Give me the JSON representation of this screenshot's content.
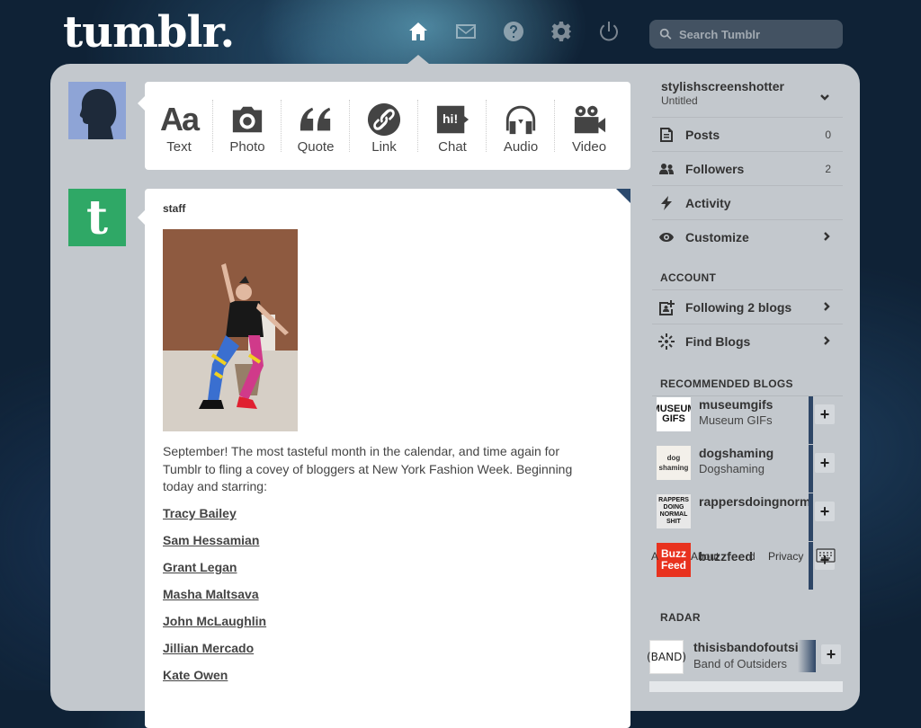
{
  "header": {
    "logo": "tumblr.",
    "nav": [
      {
        "name": "home",
        "icon": "home-icon",
        "active": true
      },
      {
        "name": "inbox",
        "icon": "envelope-icon",
        "active": false
      },
      {
        "name": "help",
        "icon": "question-icon",
        "active": false
      },
      {
        "name": "settings",
        "icon": "gear-icon",
        "active": false
      },
      {
        "name": "logout",
        "icon": "power-icon",
        "active": false
      }
    ],
    "search_placeholder": "Search Tumblr"
  },
  "composer": {
    "types": [
      {
        "label": "Text",
        "icon": "text-icon",
        "glyph": "Aa"
      },
      {
        "label": "Photo",
        "icon": "camera-icon"
      },
      {
        "label": "Quote",
        "icon": "quote-icon"
      },
      {
        "label": "Link",
        "icon": "link-icon"
      },
      {
        "label": "Chat",
        "icon": "chat-icon",
        "glyph": "hi!"
      },
      {
        "label": "Audio",
        "icon": "headphones-icon"
      },
      {
        "label": "Video",
        "icon": "video-camera-icon"
      }
    ]
  },
  "post": {
    "author": "staff",
    "avatar_letter": "t",
    "body": "September! The most tasteful month in the calendar, and time again for Tumblr to fling a covey of bloggers at New York Fashion Week. Beginning today and starring:",
    "links": [
      "Tracy Bailey",
      "Sam Hessamian",
      "Grant Legan",
      "Masha Maltsava",
      "John McLaughlin",
      "Jillian Mercado",
      "Kate Owen"
    ]
  },
  "sidebar": {
    "blog_name": "stylishscreenshotter",
    "blog_title": "Untitled",
    "stats": [
      {
        "label": "Posts",
        "count": "0",
        "icon": "posts-icon"
      },
      {
        "label": "Followers",
        "count": "2",
        "icon": "followers-icon"
      },
      {
        "label": "Activity",
        "count": "",
        "icon": "lightning-icon"
      },
      {
        "label": "Customize",
        "count": "",
        "icon": "eye-icon",
        "arrow": true
      }
    ],
    "account_heading": "ACCOUNT",
    "account": [
      {
        "label": "Following 2 blogs",
        "icon": "following-icon"
      },
      {
        "label": "Find Blogs",
        "icon": "find-blogs-icon"
      }
    ],
    "recommended_heading": "RECOMMENDED BLOGS",
    "recommended": [
      {
        "name": "museumgifs",
        "subtitle": "Museum GIFs",
        "avatar_text": "MUSEUM GIFS",
        "avatar_bg": "#ffffff",
        "avatar_fg": "#111111"
      },
      {
        "name": "dogshaming",
        "subtitle": "Dogshaming",
        "avatar_text": "dog shaming",
        "avatar_bg": "#f3f0ea",
        "avatar_fg": "#333333"
      },
      {
        "name": "rappersdoingnormalshit",
        "subtitle": "",
        "avatar_text": "RAPPERS DOING NORMAL SHIT",
        "avatar_bg": "#e8e8e8",
        "avatar_fg": "#111111"
      },
      {
        "name": "buzzfeed",
        "subtitle": "",
        "avatar_text": "Buzz Feed",
        "avatar_bg": "#e8321e",
        "avatar_fg": "#ffffff"
      }
    ],
    "footer_overlay": {
      "a": "A",
      "about": "About",
      "privacy": "Privacy",
      "d": "d"
    },
    "radar_heading": "RADAR",
    "radar": {
      "name": "thisisbandofoutsiders",
      "subtitle": "Band of Outsiders",
      "avatar_text": "(BAND)"
    }
  },
  "colors": {
    "panel": "#c3c8cd",
    "staff_green": "#2fa866",
    "accent_navy": "#2e4666"
  }
}
